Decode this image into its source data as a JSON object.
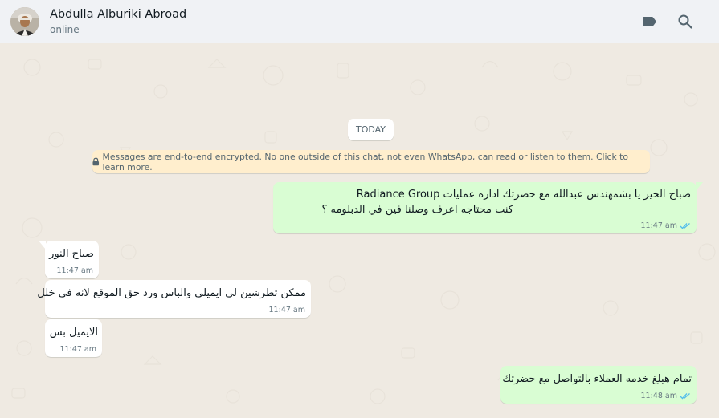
{
  "header": {
    "contact_name": "Abdulla Alburiki Abroad",
    "status": "online",
    "icons": [
      "avatar",
      "label-icon",
      "search-icon"
    ]
  },
  "chat": {
    "date_chip": "TODAY",
    "encryption_notice": "Messages are end-to-end encrypted. No one outside of this chat, not even WhatsApp, can read or listen to them. Click to learn more.",
    "messages": [
      {
        "direction": "outgoing",
        "lines": [
          "صباح الخير يا بشمهندس عبدالله مع حضرتك اداره عمليات Radiance Group",
          "كنت محتاجه اعرف وصلنا فين في الدبلومه ؟"
        ],
        "time": "11:47 am",
        "status": "read"
      },
      {
        "direction": "incoming",
        "lines": [
          "صباح النور"
        ],
        "time": "11:47 am"
      },
      {
        "direction": "incoming",
        "lines": [
          "ممكن تطرشين لي ايميلي والباس ورد حق الموقع لانه في خلل"
        ],
        "time": "11:47 am"
      },
      {
        "direction": "incoming",
        "lines": [
          "الايميل بس"
        ],
        "time": "11:47 am"
      },
      {
        "direction": "outgoing",
        "lines": [
          "تمام هبلغ خدمه العملاء بالتواصل مع حضرتك"
        ],
        "time": "11:48 am",
        "status": "read"
      }
    ]
  },
  "colors": {
    "header_bg": "#f0f2f5",
    "chat_bg": "#efeae2",
    "outgoing_bubble": "#d9fdd3",
    "incoming_bubble": "#ffffff",
    "notice_bg": "#ffeecd",
    "read_tick": "#53bdeb",
    "icon": "#54656f"
  }
}
